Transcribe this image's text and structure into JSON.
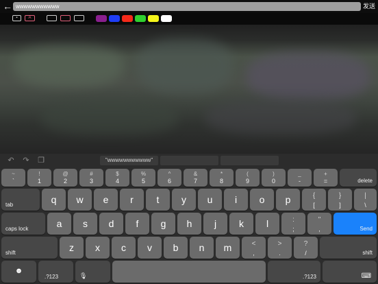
{
  "top": {
    "back_icon": "←",
    "input_value": "wwwwwwwwwww",
    "send_label": "发送"
  },
  "toolbar": {
    "buttons": [
      "▪",
      "A",
      "",
      "",
      ""
    ],
    "swatch_colors": [
      "#8a1f8e",
      "#1f3df5",
      "#f52a1a",
      "#2fd12f",
      "#f5f51a",
      "#ffffff"
    ]
  },
  "suggest": {
    "undo_icon": "↶",
    "redo_icon": "↷",
    "paste_icon": "❐",
    "text": "\"wwwwwwwwwww\""
  },
  "keys": {
    "row1": [
      {
        "top": "~",
        "bot": "`"
      },
      {
        "top": "!",
        "bot": "1"
      },
      {
        "top": "@",
        "bot": "2"
      },
      {
        "top": "#",
        "bot": "3"
      },
      {
        "top": "$",
        "bot": "4"
      },
      {
        "top": "%",
        "bot": "5"
      },
      {
        "top": "^",
        "bot": "6"
      },
      {
        "top": "&",
        "bot": "7"
      },
      {
        "top": "*",
        "bot": "8"
      },
      {
        "top": "(",
        "bot": "9"
      },
      {
        "top": ")",
        "bot": "0"
      },
      {
        "top": "_",
        "bot": "-"
      },
      {
        "top": "+",
        "bot": "="
      }
    ],
    "delete": "delete",
    "tab": "tab",
    "row2": [
      "q",
      "w",
      "e",
      "r",
      "t",
      "y",
      "u",
      "i",
      "o",
      "p"
    ],
    "row2_sym": [
      {
        "top": "{",
        "bot": "["
      },
      {
        "top": "}",
        "bot": "]"
      },
      {
        "top": "|",
        "bot": "\\"
      }
    ],
    "caps": "caps lock",
    "row3": [
      "a",
      "s",
      "d",
      "f",
      "g",
      "h",
      "j",
      "k",
      "l"
    ],
    "row3_sym": [
      {
        "top": ":",
        "bot": ";"
      },
      {
        "top": "\"",
        "bot": ","
      }
    ],
    "send": "Send",
    "shift": "shift",
    "row4": [
      "z",
      "x",
      "c",
      "v",
      "b",
      "n",
      "m"
    ],
    "row4_sym": [
      {
        "top": "<",
        "bot": ","
      },
      {
        "top": ">",
        "bot": "."
      },
      {
        "top": "?",
        "bot": "/"
      }
    ],
    "emoji": "☻",
    "num": ".?123",
    "mic": "🎙",
    "dismiss": "⌨"
  }
}
